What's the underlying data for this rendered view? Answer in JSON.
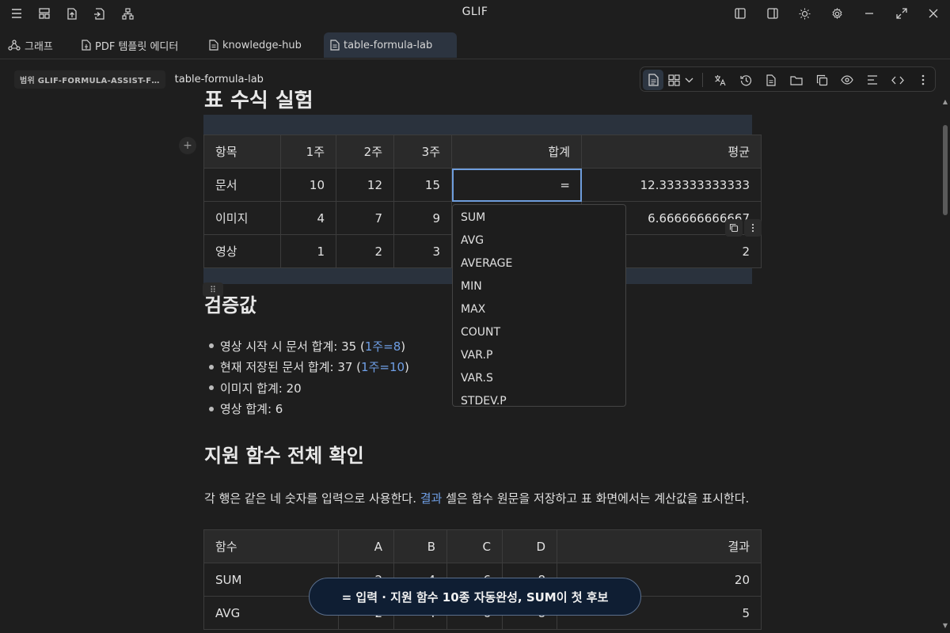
{
  "window": {
    "title": "GLIF",
    "left_icons": [
      "menu-icon",
      "layout-icon",
      "upload-file-icon",
      "file-export-icon",
      "sitemap-icon"
    ],
    "right_icons": [
      "left-panel-icon",
      "right-panel-icon",
      "sun-icon",
      "gear-icon",
      "minimize-icon",
      "maximize-icon",
      "close-icon"
    ]
  },
  "tabs": [
    {
      "label": "그래프",
      "icon": "graph-icon",
      "active": false
    },
    {
      "label": "PDF 템플릿 에디터",
      "icon": "file-icon",
      "active": false
    },
    {
      "label": "knowledge-hub",
      "icon": "document-icon",
      "active": false
    },
    {
      "label": "table-formula-lab",
      "icon": "document-icon",
      "active": true
    }
  ],
  "breadcrumb": {
    "scope": "범위 GLIF-FORMULA-ASSIST-F…",
    "page": "table-formula-lab"
  },
  "toolbar": {
    "items": [
      "document-view-icon",
      "grid-view-icon",
      "chevron-down-icon",
      "translate-icon",
      "history-icon",
      "page-icon",
      "folder-icon",
      "copy-icon",
      "eye-icon",
      "align-icon",
      "code-icon",
      "more-icon"
    ]
  },
  "doc": {
    "title_partial": "표 수식 실험",
    "table1": {
      "headers": [
        "항목",
        "1주",
        "2주",
        "3주",
        "합계",
        "평균"
      ],
      "rows": [
        [
          "문서",
          "10",
          "12",
          "15",
          "=",
          "12.333333333333"
        ],
        [
          "이미지",
          "4",
          "7",
          "9",
          "",
          "6.666666666667"
        ],
        [
          "영상",
          "1",
          "2",
          "3",
          "",
          "2"
        ]
      ]
    },
    "autocomplete": [
      "SUM",
      "AVG",
      "AVERAGE",
      "MIN",
      "MAX",
      "COUNT",
      "VAR.P",
      "VAR.S",
      "STDEV.P"
    ],
    "verify": {
      "heading": "검증값",
      "items": [
        {
          "text": "영상 시작 시 문서 합계: 35 (",
          "link": "1주=8",
          "tail": ")"
        },
        {
          "text": "현재 저장된 문서 합계: 37 (",
          "link": "1주=10",
          "tail": ")"
        },
        {
          "text": "이미지 합계: 20",
          "link": "",
          "tail": ""
        },
        {
          "text": "영상 합계: 6",
          "link": "",
          "tail": ""
        }
      ]
    },
    "support": {
      "heading": "지원 함수 전체 확인",
      "desc_pre": "각 행은 같은 네 숫자를 입력으로 사용한다. ",
      "desc_link": "결과",
      "desc_post": " 셀은 함수 원문을 저장하고 표 화면에서는 계산값을 표시한다."
    },
    "table2": {
      "headers": [
        "함수",
        "A",
        "B",
        "C",
        "D",
        "결과"
      ],
      "rows": [
        [
          "SUM",
          "2",
          "4",
          "6",
          "8",
          "20"
        ],
        [
          "AVG",
          "2",
          "4",
          "6",
          "8",
          "5"
        ]
      ]
    }
  },
  "toast": "= 입력 · 지원 함수 10종 자동완성, SUM이 첫 후보"
}
